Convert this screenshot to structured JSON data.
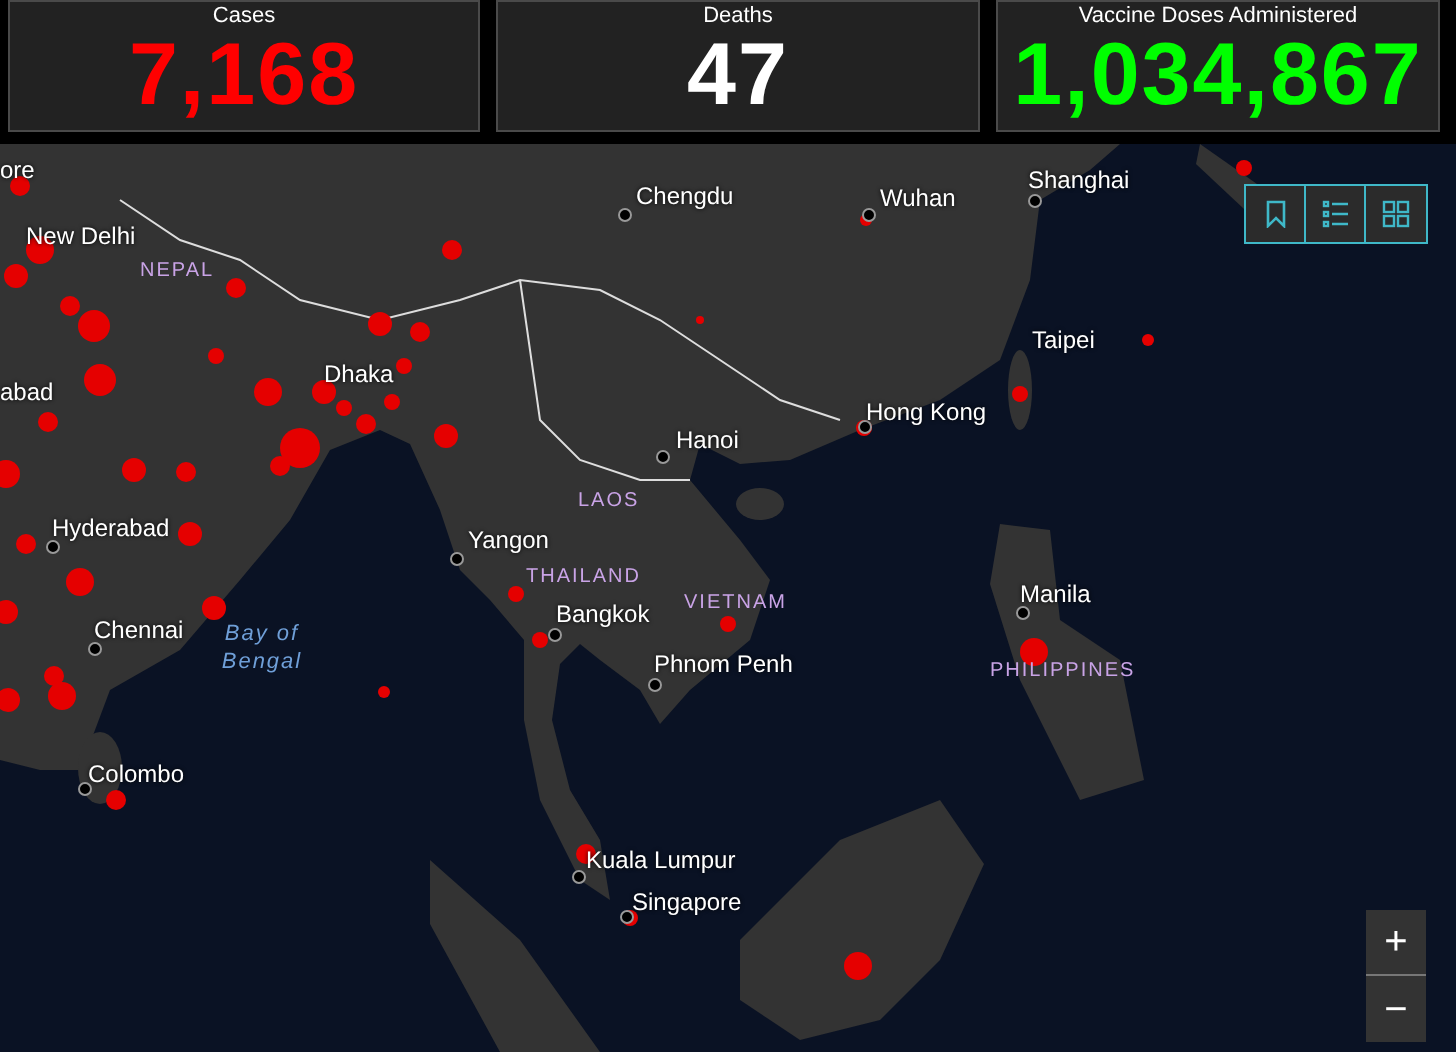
{
  "stats": [
    {
      "label": "Cases",
      "value": "7,168",
      "color": "#ff0000"
    },
    {
      "label": "Deaths",
      "value": "47",
      "color": "#ffffff"
    },
    {
      "label": "Vaccine Doses Administered",
      "value": "1,034,867",
      "color": "#00ff00"
    }
  ],
  "map": {
    "labels": [
      {
        "kind": "edge",
        "text": "ore"
      },
      {
        "kind": "city",
        "text": "New Delhi"
      },
      {
        "kind": "country",
        "text": "NEPAL"
      },
      {
        "kind": "edge",
        "text": "abad"
      },
      {
        "kind": "city",
        "text": "Hyderabad"
      },
      {
        "kind": "city",
        "text": "Chennai"
      },
      {
        "kind": "water",
        "text": "Bay of Bengal"
      },
      {
        "kind": "city",
        "text": "Colombo"
      },
      {
        "kind": "city",
        "text": "Dhaka"
      },
      {
        "kind": "city",
        "text": "Chengdu"
      },
      {
        "kind": "city",
        "text": "Wuhan"
      },
      {
        "kind": "city",
        "text": "Shanghai"
      },
      {
        "kind": "city",
        "text": "Taipei"
      },
      {
        "kind": "city",
        "text": "Hong Kong"
      },
      {
        "kind": "city",
        "text": "Hanoi"
      },
      {
        "kind": "country",
        "text": "LAOS"
      },
      {
        "kind": "city",
        "text": "Yangon"
      },
      {
        "kind": "country",
        "text": "THAILAND"
      },
      {
        "kind": "country",
        "text": "VIETNAM"
      },
      {
        "kind": "city",
        "text": "Bangkok"
      },
      {
        "kind": "city",
        "text": "Phnom Penh"
      },
      {
        "kind": "city",
        "text": "Manila"
      },
      {
        "kind": "country",
        "text": "PHILIPPINES"
      },
      {
        "kind": "city",
        "text": "Kuala Lumpur"
      },
      {
        "kind": "city",
        "text": "Singapore"
      }
    ],
    "zoom": [
      "+",
      "−"
    ]
  }
}
